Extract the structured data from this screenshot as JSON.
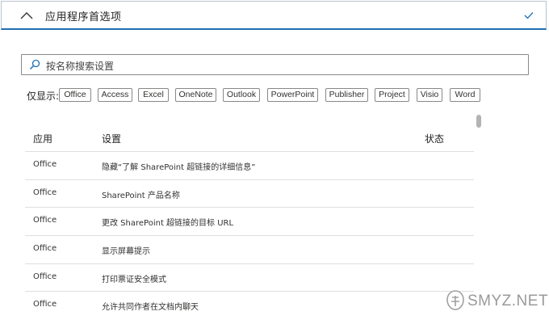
{
  "header": {
    "title": "应用程序首选项",
    "collapse_icon": "chevron-up-icon",
    "status_icon": "checkmark-icon"
  },
  "search": {
    "placeholder": "按名称搜索设置",
    "icon": "search-icon"
  },
  "filters": {
    "label": "仅显示:",
    "chips": [
      "Office",
      "Access",
      "Excel",
      "OneNote",
      "Outlook",
      "PowerPoint",
      "Publisher",
      "Project",
      "Visio",
      "Word"
    ]
  },
  "table": {
    "columns": [
      "应用",
      "设置",
      "状态"
    ],
    "rows": [
      {
        "app": "Office",
        "setting": "隐藏“了解 SharePoint 超链接的详细信息”",
        "status": ""
      },
      {
        "app": "Office",
        "setting": "SharePoint 产品名称",
        "status": ""
      },
      {
        "app": "Office",
        "setting": "更改 SharePoint 超链接的目标 URL",
        "status": ""
      },
      {
        "app": "Office",
        "setting": "显示屏幕提示",
        "status": ""
      },
      {
        "app": "Office",
        "setting": "打印票证安全模式",
        "status": ""
      },
      {
        "app": "Office",
        "setting": "允许共同作者在文档内聊天",
        "status": ""
      }
    ]
  },
  "watermark": {
    "text": "SMYZ.NET"
  },
  "colors": {
    "accent": "#1f6fb2",
    "border": "#8a8886",
    "divider": "#e1dfdd"
  }
}
